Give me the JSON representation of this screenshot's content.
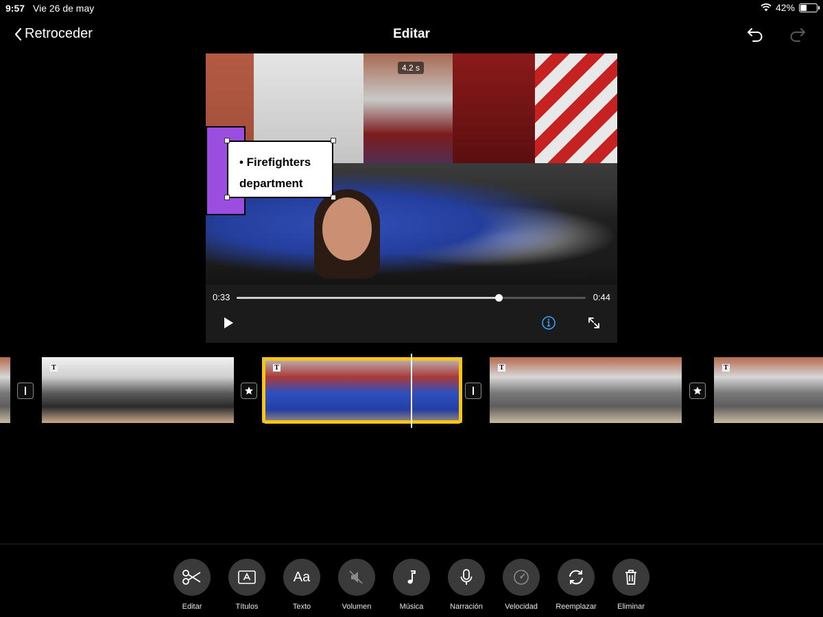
{
  "status_bar": {
    "time": "9:57",
    "date": "Vie 26 de may",
    "battery_percent": "42%",
    "battery_level": 0.42
  },
  "nav": {
    "back_label": "Retroceder",
    "title": "Editar",
    "undo_icon": "undo-icon",
    "redo_icon": "redo-icon"
  },
  "preview": {
    "duration_badge": "4.2 s",
    "title_lines": [
      "• Firefighters",
      "department"
    ],
    "current_time": "0:33",
    "total_time": "0:44",
    "progress": 0.75,
    "info_color": "#3aa0ff"
  },
  "timeline": {
    "selected_color": "#f5c518",
    "clips": [
      "classroom",
      "fire-truck-group",
      "classroom",
      "classroom"
    ]
  },
  "toolbar": [
    {
      "label": "Editar",
      "icon": "scissors-icon"
    },
    {
      "label": "Títulos",
      "icon": "titles-icon"
    },
    {
      "label": "Texto",
      "icon": "text-icon",
      "glyph": "Aa"
    },
    {
      "label": "Volumen",
      "icon": "volume-muted-icon"
    },
    {
      "label": "Música",
      "icon": "music-note-icon"
    },
    {
      "label": "Narración",
      "icon": "microphone-icon"
    },
    {
      "label": "Velocidad",
      "icon": "speedometer-icon"
    },
    {
      "label": "Reemplazar",
      "icon": "replace-icon"
    },
    {
      "label": "Eliminar",
      "icon": "trash-icon"
    }
  ]
}
